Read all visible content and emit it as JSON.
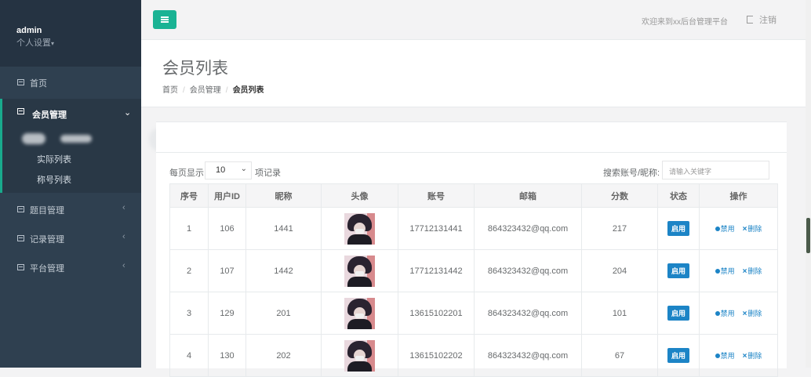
{
  "sidebar": {
    "user": "admin",
    "settings_label": "个人设置",
    "items": [
      {
        "label": "首页"
      },
      {
        "label": "会员管理",
        "sub": [
          "实际列表",
          "称号列表"
        ]
      },
      {
        "label": "题目管理"
      },
      {
        "label": "记录管理"
      },
      {
        "label": "平台管理"
      }
    ]
  },
  "header": {
    "welcome": "欢迎来到xx后台管理平台",
    "logout": "注销"
  },
  "page": {
    "title": "会员列表",
    "breadcrumb": [
      "首页",
      "会员管理",
      "会员列表"
    ]
  },
  "controls": {
    "page_size_prefix": "每页显示",
    "page_size": "10",
    "page_size_suffix": "项记录",
    "search_label": "搜索账号/昵称:",
    "search_placeholder": "请输入关键字"
  },
  "table": {
    "columns": [
      "序号",
      "用户ID",
      "昵称",
      "头像",
      "账号",
      "邮箱",
      "分数",
      "状态",
      "操作"
    ],
    "rows": [
      {
        "no": "1",
        "uid": "106",
        "nick": "1441",
        "account": "17712131441",
        "email": "864323432@qq.com",
        "score": "217",
        "status": "启用"
      },
      {
        "no": "2",
        "uid": "107",
        "nick": "1442",
        "account": "17712131442",
        "email": "864323432@qq.com",
        "score": "204",
        "status": "启用"
      },
      {
        "no": "3",
        "uid": "129",
        "nick": "201",
        "account": "13615102201",
        "email": "864323432@qq.com",
        "score": "101",
        "status": "启用"
      },
      {
        "no": "4",
        "uid": "130",
        "nick": "202",
        "account": "13615102202",
        "email": "864323432@qq.com",
        "score": "67",
        "status": "启用"
      }
    ],
    "disable_label": "禁用",
    "delete_label": "删除"
  },
  "colors": {
    "accent": "#1ab394",
    "sidebar": "#2f4050",
    "badge": "#1c84c6"
  }
}
